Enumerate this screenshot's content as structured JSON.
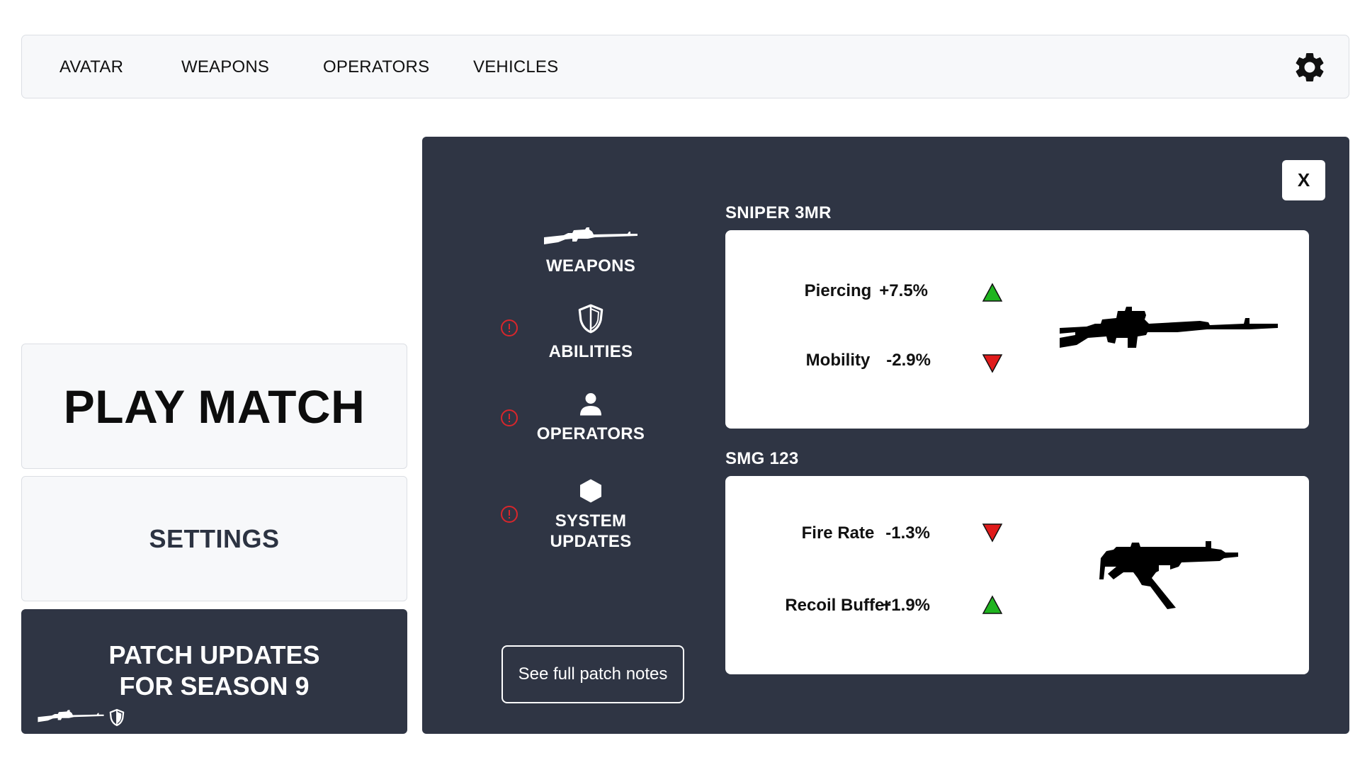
{
  "nav": {
    "items": [
      "AVATAR",
      "WEAPONS",
      "OPERATORS",
      "VEHICLES"
    ],
    "settings_icon": "gear-icon"
  },
  "menu": {
    "play_label": "PLAY MATCH",
    "settings_label": "SETTINGS",
    "patch_label": "PATCH UPDATES\nFOR SEASON 9"
  },
  "patch_panel": {
    "close_label": "X",
    "categories": [
      {
        "label": "WEAPONS",
        "icon": "rifle-icon",
        "alert": false
      },
      {
        "label": "ABILITIES",
        "icon": "shield-icon",
        "alert": true
      },
      {
        "label": "OPERATORS",
        "icon": "person-icon",
        "alert": true
      },
      {
        "label": "SYSTEM\nUPDATES",
        "icon": "hexagon-icon",
        "alert": true
      }
    ],
    "full_notes_label": "See full patch notes",
    "weapons": [
      {
        "name": "SNIPER 3MR",
        "image": "sniper-rifle-icon",
        "stats": [
          {
            "label": "Piercing",
            "value": "+7.5%",
            "trend": "up"
          },
          {
            "label": "Mobility",
            "value": "-2.9%",
            "trend": "down"
          }
        ]
      },
      {
        "name": "SMG 123",
        "image": "smg-icon",
        "stats": [
          {
            "label": "Fire Rate",
            "value": "-1.3%",
            "trend": "down"
          },
          {
            "label": "Recoil Buffer",
            "value": "+1.9%",
            "trend": "up"
          }
        ]
      }
    ]
  },
  "colors": {
    "panel_bg": "#2f3544",
    "card_bg": "#f7f8fa",
    "up": "#1fb41f",
    "down": "#e01b1b",
    "alert": "#d9262b"
  }
}
